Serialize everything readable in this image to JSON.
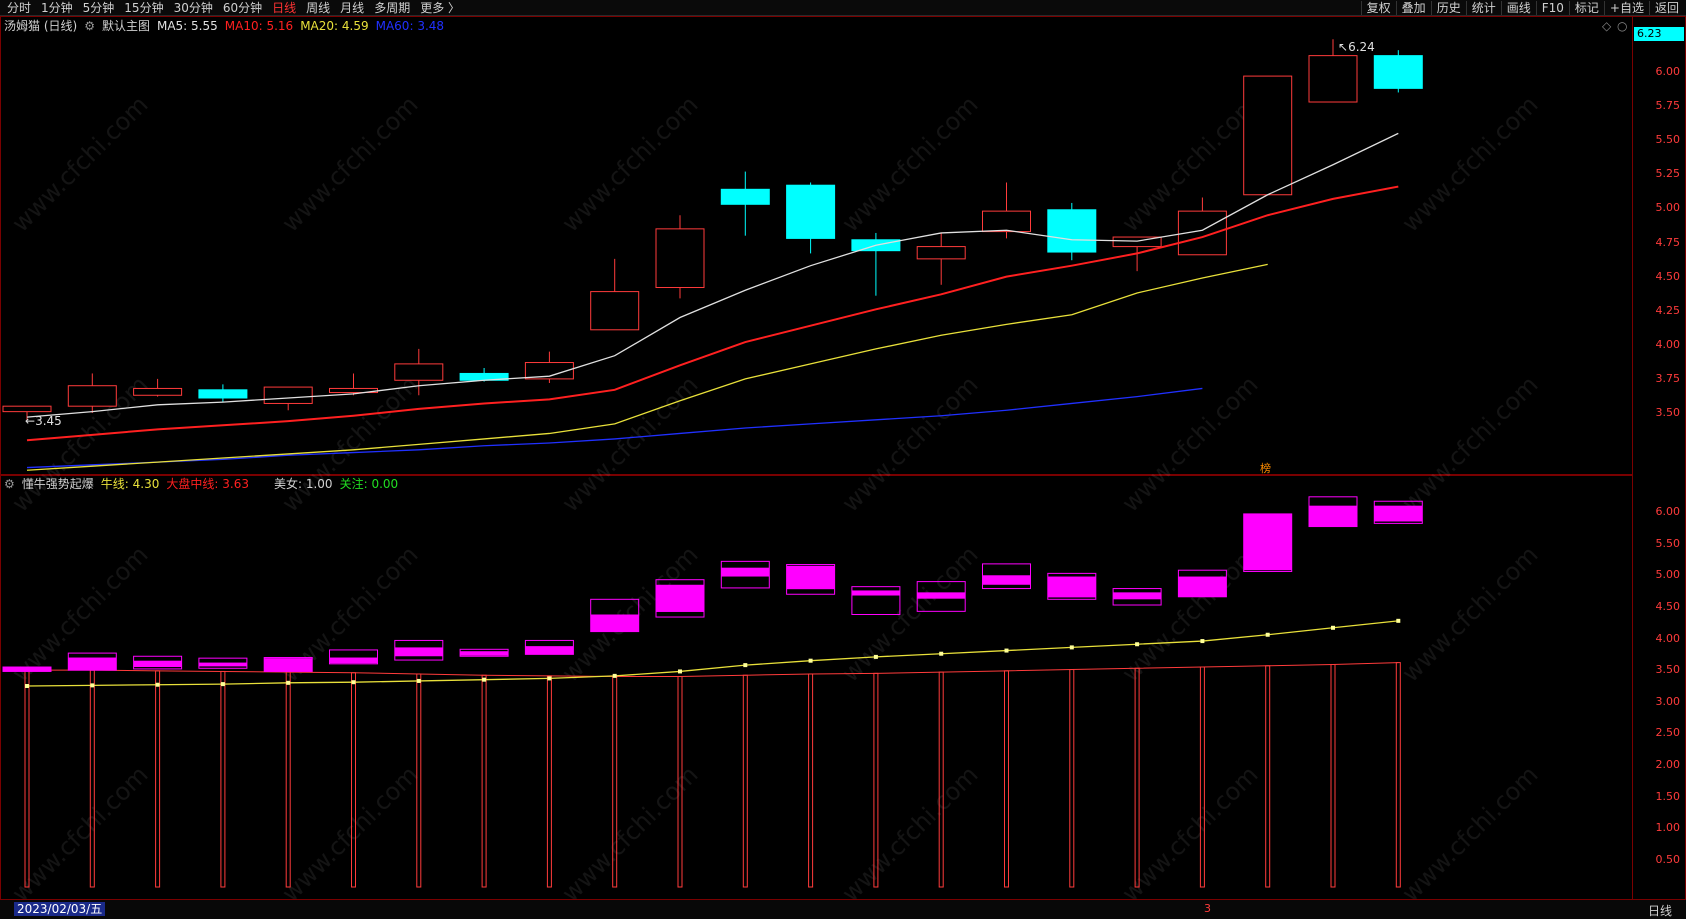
{
  "toolbar": {
    "left_items": [
      "分时",
      "1分钟",
      "5分钟",
      "15分钟",
      "30分钟",
      "60分钟",
      "日线",
      "周线",
      "月线",
      "多周期",
      "更多 〉"
    ],
    "active_item": "日线",
    "right_items": [
      "复权",
      "叠加",
      "历史",
      "统计",
      "画线",
      "F10",
      "标记",
      "+自选",
      "返回"
    ]
  },
  "main_info": {
    "stock_name": "汤姆猫 (日线)",
    "chart_name": "默认主图",
    "ma5_label": "MA5:",
    "ma5_value": "5.55",
    "ma10_label": "MA10:",
    "ma10_value": "5.16",
    "ma20_label": "MA20:",
    "ma20_value": "4.59",
    "ma60_label": "MA60:",
    "ma60_value": "3.48"
  },
  "indicator_info": {
    "name": "懂牛强势起爆",
    "niu_label": "牛线:",
    "niu_value": "4.30",
    "dapan_label": "大盘中线:",
    "dapan_value": "3.63",
    "meinv_label": "美女:",
    "meinv_value": "1.00",
    "guanzhu_label": "关注:",
    "guanzhu_value": "0.00"
  },
  "current_price": "6.23",
  "high_marker": "6.24",
  "low_marker": "3.45",
  "bang_marker": "榜",
  "bottom": {
    "date": "2023/02/03/五",
    "marker": "3",
    "period": "日线"
  },
  "watermark": "www.cfchi.com",
  "colors": {
    "up": "#ff3b3b",
    "down": "#00ffff",
    "ma5": "#e0e0e0",
    "ma10": "#ff2020",
    "ma20": "#e8e03a",
    "ma60": "#2030ff",
    "magenta": "#ff00ff",
    "grid_border": "#7a0000"
  },
  "chart_data": [
    {
      "type": "candlestick",
      "title": "汤姆猫 (日线)",
      "y_ticks": [
        "6.00",
        "5.75",
        "5.50",
        "5.25",
        "5.00",
        "4.75",
        "4.50",
        "4.25",
        "4.00",
        "3.75",
        "3.50"
      ],
      "ylim": [
        3.05,
        6.35
      ],
      "candles": [
        {
          "o": 3.51,
          "h": 3.55,
          "l": 3.45,
          "c": 3.55
        },
        {
          "o": 3.55,
          "h": 3.79,
          "l": 3.5,
          "c": 3.7
        },
        {
          "o": 3.63,
          "h": 3.75,
          "l": 3.62,
          "c": 3.68
        },
        {
          "o": 3.67,
          "h": 3.71,
          "l": 3.58,
          "c": 3.61
        },
        {
          "o": 3.57,
          "h": 3.69,
          "l": 3.52,
          "c": 3.69
        },
        {
          "o": 3.65,
          "h": 3.79,
          "l": 3.63,
          "c": 3.68
        },
        {
          "o": 3.74,
          "h": 3.97,
          "l": 3.63,
          "c": 3.86
        },
        {
          "o": 3.79,
          "h": 3.83,
          "l": 3.73,
          "c": 3.74
        },
        {
          "o": 3.75,
          "h": 3.95,
          "l": 3.72,
          "c": 3.87
        },
        {
          "o": 4.11,
          "h": 4.63,
          "l": 4.11,
          "c": 4.39
        },
        {
          "o": 4.42,
          "h": 4.95,
          "l": 4.34,
          "c": 4.85
        },
        {
          "o": 5.14,
          "h": 5.27,
          "l": 4.8,
          "c": 5.03
        },
        {
          "o": 5.17,
          "h": 5.19,
          "l": 4.67,
          "c": 4.78
        },
        {
          "o": 4.77,
          "h": 4.82,
          "l": 4.36,
          "c": 4.69
        },
        {
          "o": 4.63,
          "h": 4.82,
          "l": 4.44,
          "c": 4.72
        },
        {
          "o": 4.83,
          "h": 5.19,
          "l": 4.78,
          "c": 4.98
        },
        {
          "o": 4.99,
          "h": 5.04,
          "l": 4.62,
          "c": 4.68
        },
        {
          "o": 4.72,
          "h": 4.79,
          "l": 4.54,
          "c": 4.79
        },
        {
          "o": 4.66,
          "h": 5.08,
          "l": 4.66,
          "c": 4.98
        },
        {
          "o": 5.1,
          "h": 5.97,
          "l": 5.1,
          "c": 5.97
        },
        {
          "o": 5.78,
          "h": 6.24,
          "l": 5.78,
          "c": 6.12
        },
        {
          "o": 6.12,
          "h": 6.16,
          "l": 5.85,
          "c": 5.88
        }
      ],
      "ma5": [
        3.47,
        3.51,
        3.56,
        3.58,
        3.61,
        3.64,
        3.7,
        3.74,
        3.77,
        3.92,
        4.2,
        4.4,
        4.58,
        4.73,
        4.82,
        4.84,
        4.77,
        4.76,
        4.84,
        5.1,
        5.32,
        5.55
      ],
      "ma10": [
        3.3,
        3.34,
        3.38,
        3.41,
        3.44,
        3.48,
        3.53,
        3.57,
        3.6,
        3.67,
        3.85,
        4.02,
        4.14,
        4.26,
        4.37,
        4.5,
        4.58,
        4.67,
        4.79,
        4.95,
        5.07,
        5.16
      ],
      "ma20": [
        3.08,
        3.11,
        3.14,
        3.17,
        3.2,
        3.23,
        3.27,
        3.31,
        3.35,
        3.42,
        3.59,
        3.75,
        3.86,
        3.97,
        4.07,
        4.15,
        4.22,
        4.38,
        4.49,
        4.59
      ],
      "ma60": [
        3.1,
        3.12,
        3.14,
        3.16,
        3.19,
        3.21,
        3.23,
        3.26,
        3.28,
        3.31,
        3.35,
        3.39,
        3.42,
        3.45,
        3.48,
        3.52,
        3.57,
        3.62,
        3.68
      ]
    },
    {
      "type": "indicator",
      "title": "懂牛强势起爆",
      "y_ticks": [
        "6.00",
        "5.50",
        "5.00",
        "4.50",
        "4.00",
        "3.50",
        "3.00",
        "2.50",
        "2.00",
        "1.50",
        "1.00",
        "0.50"
      ],
      "ylim": [
        0.0,
        6.5
      ],
      "boxes": [
        {
          "top": 3.55,
          "bot": 3.48,
          "ftop": 3.55,
          "fbot": 3.48
        },
        {
          "top": 3.77,
          "bot": 3.5,
          "ftop": 3.7,
          "fbot": 3.5
        },
        {
          "top": 3.72,
          "bot": 3.52,
          "ftop": 3.65,
          "fbot": 3.55
        },
        {
          "top": 3.69,
          "bot": 3.53,
          "ftop": 3.62,
          "fbot": 3.56
        },
        {
          "top": 3.7,
          "bot": 3.48,
          "ftop": 3.69,
          "fbot": 3.48
        },
        {
          "top": 3.82,
          "bot": 3.6,
          "ftop": 3.7,
          "fbot": 3.61
        },
        {
          "top": 3.97,
          "bot": 3.66,
          "ftop": 3.86,
          "fbot": 3.72
        },
        {
          "top": 3.83,
          "bot": 3.72,
          "ftop": 3.8,
          "fbot": 3.73
        },
        {
          "top": 3.97,
          "bot": 3.75,
          "ftop": 3.88,
          "fbot": 3.75
        },
        {
          "top": 4.62,
          "bot": 4.11,
          "ftop": 4.38,
          "fbot": 4.11
        },
        {
          "top": 4.93,
          "bot": 4.34,
          "ftop": 4.85,
          "fbot": 4.42
        },
        {
          "top": 5.22,
          "bot": 4.8,
          "ftop": 5.12,
          "fbot": 4.98
        },
        {
          "top": 5.17,
          "bot": 4.7,
          "ftop": 5.15,
          "fbot": 4.78
        },
        {
          "top": 4.82,
          "bot": 4.38,
          "ftop": 4.76,
          "fbot": 4.68
        },
        {
          "top": 4.9,
          "bot": 4.43,
          "ftop": 4.73,
          "fbot": 4.63
        },
        {
          "top": 5.18,
          "bot": 4.79,
          "ftop": 5.0,
          "fbot": 4.85
        },
        {
          "top": 5.03,
          "bot": 4.62,
          "ftop": 4.98,
          "fbot": 4.65
        },
        {
          "top": 4.79,
          "bot": 4.53,
          "ftop": 4.73,
          "fbot": 4.62
        },
        {
          "top": 5.08,
          "bot": 4.66,
          "ftop": 4.98,
          "fbot": 4.66
        },
        {
          "top": 5.97,
          "bot": 5.06,
          "ftop": 5.97,
          "fbot": 5.08
        },
        {
          "top": 6.24,
          "bot": 5.77,
          "ftop": 6.1,
          "fbot": 5.77
        },
        {
          "top": 6.17,
          "bot": 5.82,
          "ftop": 6.1,
          "fbot": 5.85
        }
      ],
      "niu_line": [
        3.25,
        3.26,
        3.27,
        3.28,
        3.3,
        3.31,
        3.33,
        3.35,
        3.37,
        3.41,
        3.48,
        3.58,
        3.65,
        3.71,
        3.76,
        3.81,
        3.86,
        3.91,
        3.96,
        4.06,
        4.17,
        4.28
      ],
      "dapan_line": [
        3.5,
        3.5,
        3.49,
        3.48,
        3.47,
        3.46,
        3.44,
        3.42,
        3.41,
        3.4,
        3.4,
        3.42,
        3.44,
        3.45,
        3.47,
        3.49,
        3.51,
        3.53,
        3.55,
        3.57,
        3.59,
        3.62
      ]
    }
  ]
}
